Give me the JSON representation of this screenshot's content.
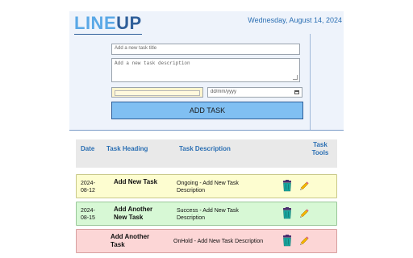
{
  "header": {
    "logo_part1": "LINE",
    "logo_part2": "UP",
    "date_text": "Wednesday, August 14, 2024"
  },
  "form": {
    "title_placeholder": "Add a new task title",
    "description_placeholder": "Add a new task description",
    "date_placeholder": "dd/mm/yyyy",
    "add_button_label": "ADD TASK"
  },
  "table": {
    "headers": {
      "date": "Date",
      "heading": "Task Heading",
      "description": "Task Description",
      "tools_line1": "Task",
      "tools_line2": "Tools"
    },
    "rows": [
      {
        "date": "2024-08-12",
        "heading": "Add New Task",
        "description": "Ongoing - Add New Task Description",
        "status": "Ongoing",
        "color": "#fdfdd0"
      },
      {
        "date": "2024-08-15",
        "heading": "Add Another New Task",
        "description": "Success - Add New Task Description",
        "status": "Success",
        "color": "#d7f8d5"
      },
      {
        "date": "",
        "heading": "Add Another Task",
        "description": "OnHold - Add New Task Description",
        "status": "OnHold",
        "color": "#fcd6d6"
      }
    ]
  },
  "icons": {
    "delete": "trash-icon",
    "edit": "pencil-icon"
  },
  "colors": {
    "accent": "#2b6fb3",
    "logo_light": "#5aa8e6",
    "logo_dark": "#2f5f9a",
    "button": "#80bff2"
  }
}
